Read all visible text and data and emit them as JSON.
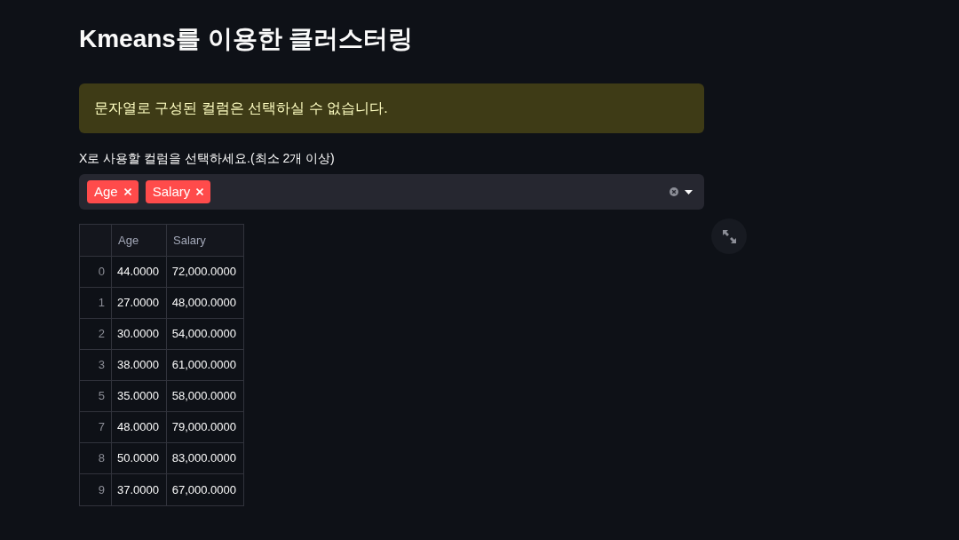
{
  "title": "Kmeans를 이용한 클러스터링",
  "warning": {
    "text": "문자열로 구성된 컬럼은 선택하실 수 없습니다."
  },
  "column_select": {
    "label": "X로 사용할 컬럼을 선택하세요.(최소 2개 이상)",
    "tags": [
      "Age",
      "Salary"
    ]
  },
  "table": {
    "columns": [
      "Age",
      "Salary"
    ],
    "rows": [
      {
        "index": "0",
        "cells": [
          "44.0000",
          "72,000.0000"
        ]
      },
      {
        "index": "1",
        "cells": [
          "27.0000",
          "48,000.0000"
        ]
      },
      {
        "index": "2",
        "cells": [
          "30.0000",
          "54,000.0000"
        ]
      },
      {
        "index": "3",
        "cells": [
          "38.0000",
          "61,000.0000"
        ]
      },
      {
        "index": "5",
        "cells": [
          "35.0000",
          "58,000.0000"
        ]
      },
      {
        "index": "7",
        "cells": [
          "48.0000",
          "79,000.0000"
        ]
      },
      {
        "index": "8",
        "cells": [
          "50.0000",
          "83,000.0000"
        ]
      },
      {
        "index": "9",
        "cells": [
          "37.0000",
          "67,000.0000"
        ]
      }
    ]
  }
}
